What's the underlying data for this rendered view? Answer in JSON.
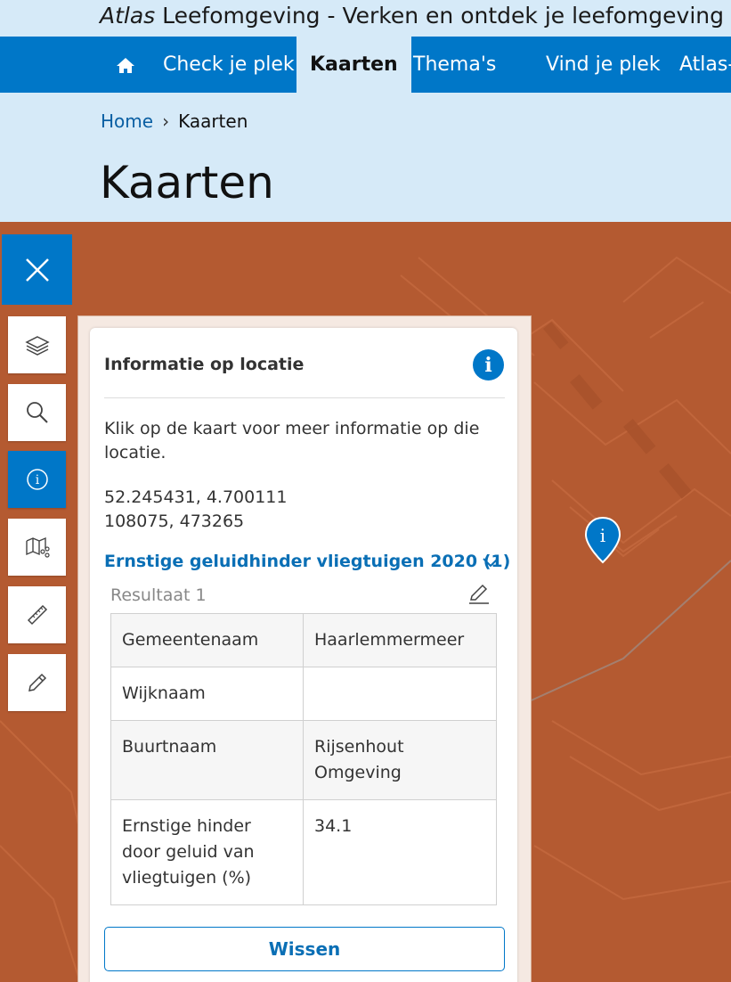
{
  "site": {
    "title_italic": "Atlas",
    "title_rest": " Leefomgeving - Verken en ontdek je leefomgeving"
  },
  "nav": {
    "items": [
      {
        "label": "Check je plek"
      },
      {
        "label": "Kaarten"
      },
      {
        "label": "Thema's"
      },
      {
        "label": "Vind je plek"
      },
      {
        "label": "Atlas-"
      }
    ],
    "active": "Kaarten"
  },
  "breadcrumb": {
    "home": "Home",
    "separator": "›",
    "current": "Kaarten"
  },
  "page": {
    "title": "Kaarten"
  },
  "panel": {
    "heading": "Informatie op locatie",
    "instruction": "Klik op de kaart voor meer informatie op die locatie.",
    "coords_wgs84": "52.245431, 4.700111",
    "coords_rd": "108075, 473265",
    "layer_title": "Ernstige geluidhinder vliegtuigen 2020 (1)",
    "result_label": "Resultaat 1",
    "rows": [
      {
        "key": "Gemeentenaam",
        "value": "Haarlemmermeer"
      },
      {
        "key": "Wijknaam",
        "value": ""
      },
      {
        "key": "Buurtnaam",
        "value": "Rijsenhout Omgeving"
      },
      {
        "key": "Ernstige hinder door geluid van vliegtuigen (%)",
        "value": "34.1"
      }
    ],
    "clear_button": "Wissen"
  },
  "colors": {
    "primary": "#0077c8",
    "light_blue": "#d6eaf8",
    "map_fill": "#b45a31"
  },
  "icons": {
    "tools": [
      "layers-icon",
      "search-icon",
      "info-icon",
      "map-share-icon",
      "ruler-icon",
      "pencil-icon"
    ]
  }
}
